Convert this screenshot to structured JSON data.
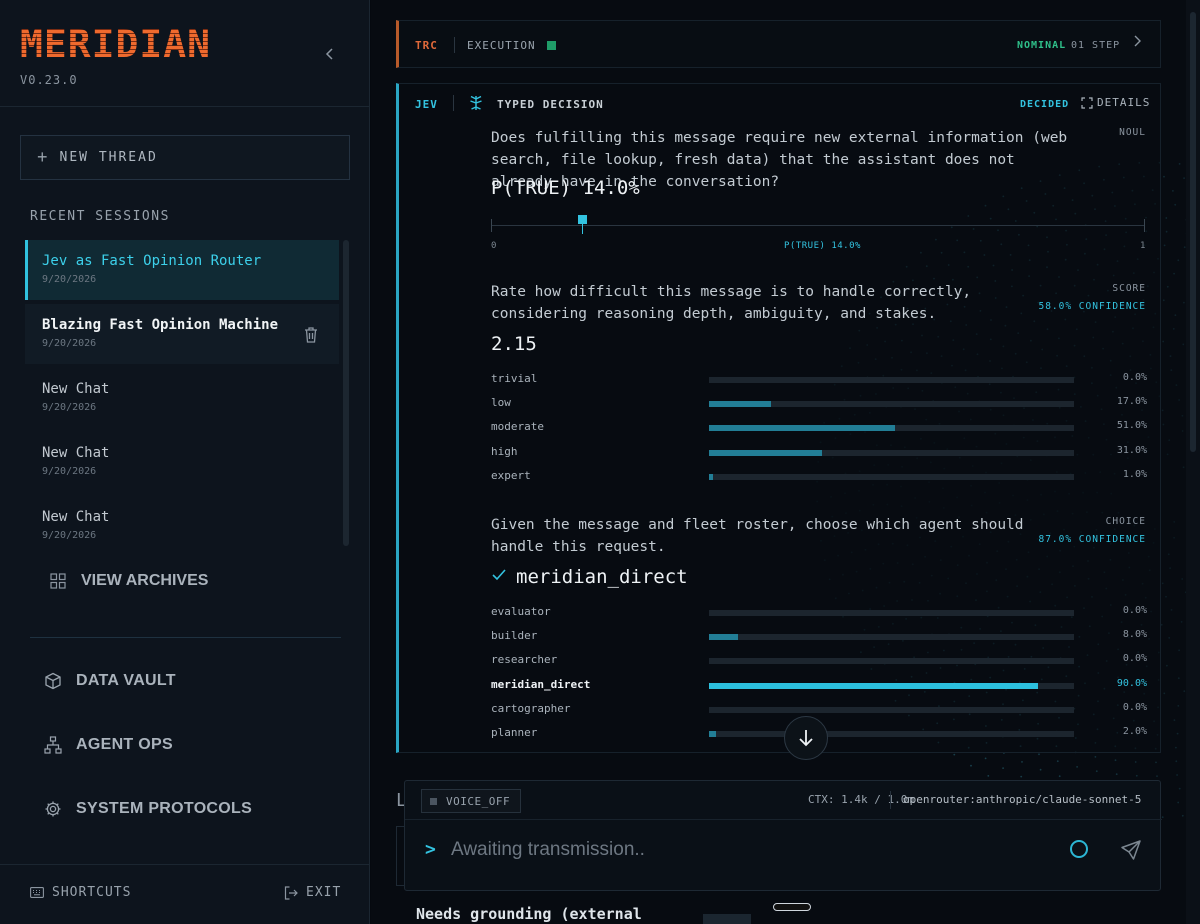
{
  "app": {
    "logo": "MERIDIAN",
    "version": "V0.23.0"
  },
  "sidebar": {
    "new_thread_label": "NEW THREAD",
    "recent_title": "RECENT SESSIONS",
    "sessions": [
      {
        "title": "Jev as Fast Opinion Router",
        "date": "9/20/2026",
        "state": "active"
      },
      {
        "title": "Blazing Fast Opinion Machine",
        "date": "9/20/2026",
        "state": "hover"
      },
      {
        "title": "New Chat",
        "date": "9/20/2026",
        "state": ""
      },
      {
        "title": "New Chat",
        "date": "9/20/2026",
        "state": ""
      },
      {
        "title": "New Chat",
        "date": "9/20/2026",
        "state": ""
      }
    ],
    "view_archives": "VIEW ARCHIVES",
    "nav": {
      "data_vault": "DATA VAULT",
      "agent_ops": "AGENT OPS",
      "system_protocols": "SYSTEM PROTOCOLS"
    },
    "shortcuts": "SHORTCUTS",
    "exit": "EXIT"
  },
  "trace": {
    "tag": "TRC",
    "label": "EXECUTION",
    "status": "NOMINAL",
    "steps": "01 STEP",
    "status_color": "#2fc08a"
  },
  "decision": {
    "tag": "JEV",
    "title": "TYPED DECISION",
    "state": "DECIDED",
    "details_label": "DETAILS",
    "q1": {
      "kind": "NOUL",
      "question": "Does fulfilling this message require new external information (web search, file lookup, fresh data) that the assistant does not already have in the conversation?",
      "result": "P(TRUE) 14.0%",
      "p_true": 0.14,
      "min_label": "0",
      "max_label": "1",
      "marker_label": "P(TRUE) 14.0%"
    },
    "q2": {
      "kind": "SCORE",
      "confidence": "58.0% CONFIDENCE",
      "question": "Rate how difficult this message is to handle correctly, considering reasoning depth, ambiguity, and stakes.",
      "result": "2.15",
      "options": [
        {
          "label": "trivial",
          "value": 0.0,
          "pct": "0.0%"
        },
        {
          "label": "low",
          "value": 17.0,
          "pct": "17.0%"
        },
        {
          "label": "moderate",
          "value": 51.0,
          "pct": "51.0%"
        },
        {
          "label": "high",
          "value": 31.0,
          "pct": "31.0%"
        },
        {
          "label": "expert",
          "value": 1.0,
          "pct": "1.0%"
        }
      ]
    },
    "q3": {
      "kind": "CHOICE",
      "confidence": "87.0% CONFIDENCE",
      "question": "Given the message and fleet roster, choose which agent should handle this request.",
      "result": "meridian_direct",
      "options": [
        {
          "label": "evaluator",
          "value": 0.0,
          "pct": "0.0%"
        },
        {
          "label": "builder",
          "value": 8.0,
          "pct": "8.0%"
        },
        {
          "label": "researcher",
          "value": 0.0,
          "pct": "0.0%"
        },
        {
          "label": "meridian_direct",
          "value": 90.0,
          "pct": "90.0%",
          "selected": true
        },
        {
          "label": "cartographer",
          "value": 0.0,
          "pct": "0.0%"
        },
        {
          "label": "planner",
          "value": 2.0,
          "pct": "2.0%"
        }
      ]
    }
  },
  "composer": {
    "voice": "VOICE_OFF",
    "ctx": "CTX: 1.4k / 1.0m",
    "model": "openrouter:anthropic/claude-sonnet-5",
    "placeholder": "Awaiting transmission..",
    "prompt_symbol": ">"
  },
  "peek": {
    "left_char": "L",
    "bottom_text": "Needs grounding (external"
  },
  "colors": {
    "accent": "#33c3e0",
    "brand": "#e35d28",
    "trace_accent": "#b75a2a"
  }
}
